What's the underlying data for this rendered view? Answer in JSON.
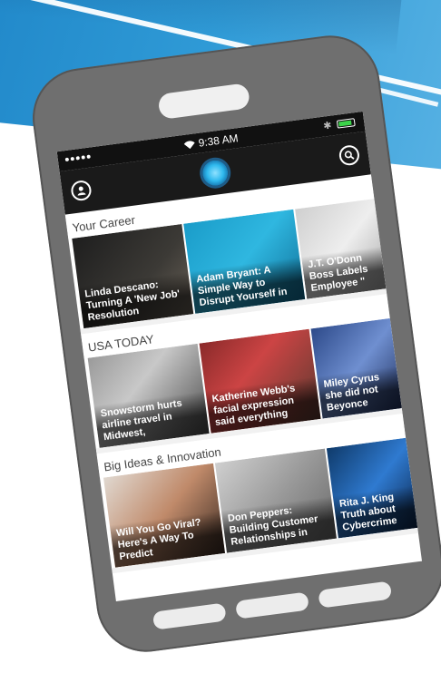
{
  "status": {
    "time": "9:38 AM"
  },
  "colors": {
    "accent": "#2fb9ee",
    "banner": "#2f9ad6",
    "phone": "#6f6f6f"
  },
  "icons": {
    "profile": "person-icon",
    "search": "search-icon",
    "logo": "app-logo-icon"
  },
  "sections": [
    {
      "title": "Your Career",
      "tiles": [
        {
          "caption": "Linda Descano: Turning A 'New Job' Resolution",
          "bg": "linear-gradient(135deg,#1e1e1e,#3c3a36 60%,#6a6258)"
        },
        {
          "caption": "Adam Bryant: A Simple Way to Disrupt Yourself in",
          "bg": "linear-gradient(135deg,#1a9cc9,#2fb7e0 50%,#0f6f98)"
        },
        {
          "caption": "J.T. O'Donn Boss Labels Employee \"",
          "bg": "linear-gradient(135deg,#cfcfcf,#eeeeee 50%,#a8a8a8)"
        }
      ]
    },
    {
      "title": "USA TODAY",
      "tiles": [
        {
          "caption": "Snowstorm hurts airline travel in Midwest,",
          "bg": "linear-gradient(135deg,#9a9a9a,#c8c8c8 40%,#4a4a4a)"
        },
        {
          "caption": "Katherine Webb's facial expression said everything",
          "bg": "linear-gradient(135deg,#8a2a2a,#c44 40%,#5a3a30)"
        },
        {
          "caption": "Miley Cyrus she did not Beyonce",
          "bg": "linear-gradient(135deg,#2d4a8a,#6f8fd0 50%,#1e2e5a)"
        }
      ]
    },
    {
      "title": "Big Ideas & Innovation",
      "tiles": [
        {
          "caption": "Will You Go Viral? Here's A Way To Predict",
          "bg": "linear-gradient(135deg,#e0d8d0,#c08a6a 50%,#3a2a22)"
        },
        {
          "caption": "Don Peppers: Building Customer Relationships in",
          "bg": "linear-gradient(135deg,#cfcfcf,#9a9a9a 50%,#6a6a6a)"
        },
        {
          "caption": "Rita J. King Truth about Cybercrime",
          "bg": "linear-gradient(135deg,#0f3a6a,#2f7ad0 50%,#0a2246)"
        }
      ]
    }
  ]
}
